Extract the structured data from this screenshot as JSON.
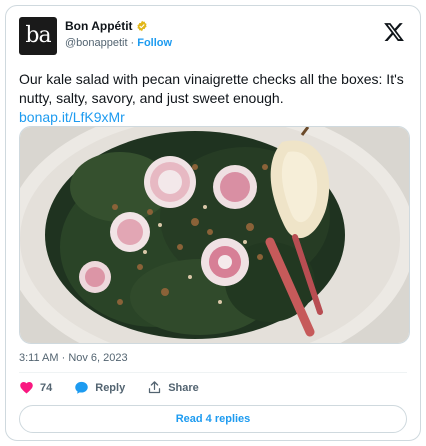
{
  "author": {
    "avatar_text": "ba",
    "display_name": "Bon Appétit",
    "handle": "@bonappetit",
    "separator": "·",
    "follow_label": "Follow"
  },
  "tweet": {
    "text": "Our kale salad with pecan vinaigrette checks all the boxes: It's nutty, salty, savory, and just sweet enough.",
    "link": "bonap.it/LfK9xMr"
  },
  "meta": {
    "timestamp": "3:11 AM · Nov 6, 2023"
  },
  "actions": {
    "like_count": "74",
    "reply_label": "Reply",
    "share_label": "Share"
  },
  "footer": {
    "read_replies_label": "Read 4 replies"
  },
  "colors": {
    "accent": "#1d9bf0",
    "like": "#f91880",
    "verified": "#e2b719",
    "text_primary": "#0f1419",
    "text_secondary": "#536471"
  },
  "icons": [
    "verified-badge-icon",
    "x-logo-icon",
    "heart-icon",
    "reply-bubble-icon",
    "share-icon"
  ]
}
